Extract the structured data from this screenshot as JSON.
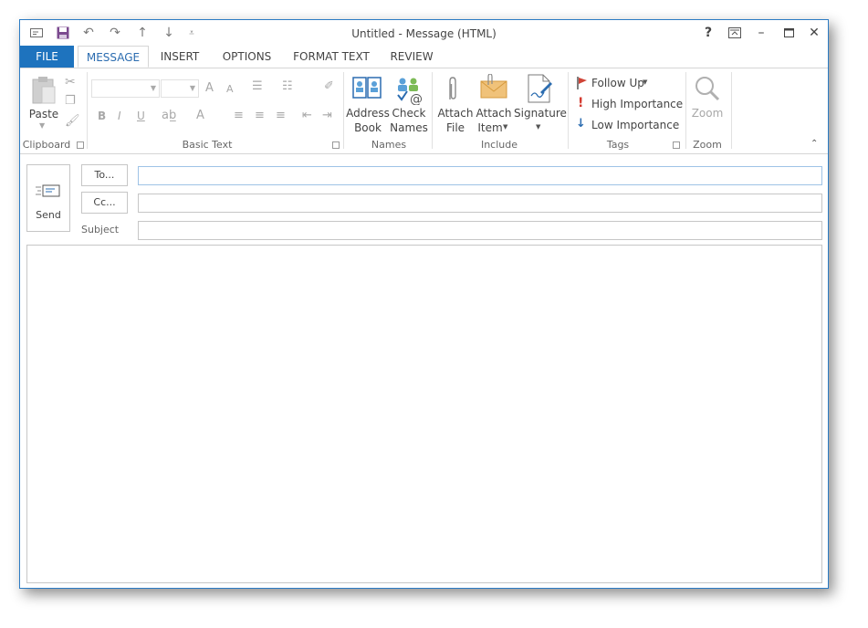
{
  "window": {
    "title": "Untitled - Message (HTML)"
  },
  "qat": {
    "icons": [
      "envelope-icon",
      "save-icon",
      "undo-icon",
      "redo-icon",
      "arrow-up-icon",
      "arrow-down-icon",
      "customize-qat-icon"
    ]
  },
  "window_controls": {
    "help": "?",
    "ribbon_display": "⊼",
    "minimize": "–",
    "maximize": "□",
    "close": "✕"
  },
  "tabs": [
    {
      "label": "FILE"
    },
    {
      "label": "MESSAGE"
    },
    {
      "label": "INSERT"
    },
    {
      "label": "OPTIONS"
    },
    {
      "label": "FORMAT TEXT"
    },
    {
      "label": "REVIEW"
    }
  ],
  "ribbon": {
    "clipboard": {
      "group_label": "Clipboard",
      "paste_label": "Paste"
    },
    "basic_text": {
      "group_label": "Basic Text",
      "bold": "B",
      "italic": "I",
      "underline": "U",
      "font_color": "A",
      "grow_font": "A",
      "shrink_font": "A"
    },
    "names": {
      "group_label": "Names",
      "address_book_line1": "Address",
      "address_book_line2": "Book",
      "check_names_line1": "Check",
      "check_names_line2": "Names"
    },
    "include": {
      "group_label": "Include",
      "attach_file_line1": "Attach",
      "attach_file_line2": "File",
      "attach_item_line1": "Attach",
      "attach_item_line2": "Item",
      "signature": "Signature"
    },
    "tags": {
      "group_label": "Tags",
      "follow_up": "Follow Up",
      "high_importance": "High Importance",
      "low_importance": "Low Importance"
    },
    "zoom": {
      "group_label": "Zoom",
      "zoom_label": "Zoom"
    }
  },
  "compose": {
    "send_label": "Send",
    "to_label": "To...",
    "cc_label": "Cc...",
    "subject_label": "Subject",
    "to_value": "",
    "cc_value": "",
    "subject_value": "",
    "body": ""
  },
  "colors": {
    "accent": "#1e73be",
    "flag_red": "#d04437",
    "importance_red": "#d43a2f",
    "importance_blue": "#2b6cb0"
  }
}
